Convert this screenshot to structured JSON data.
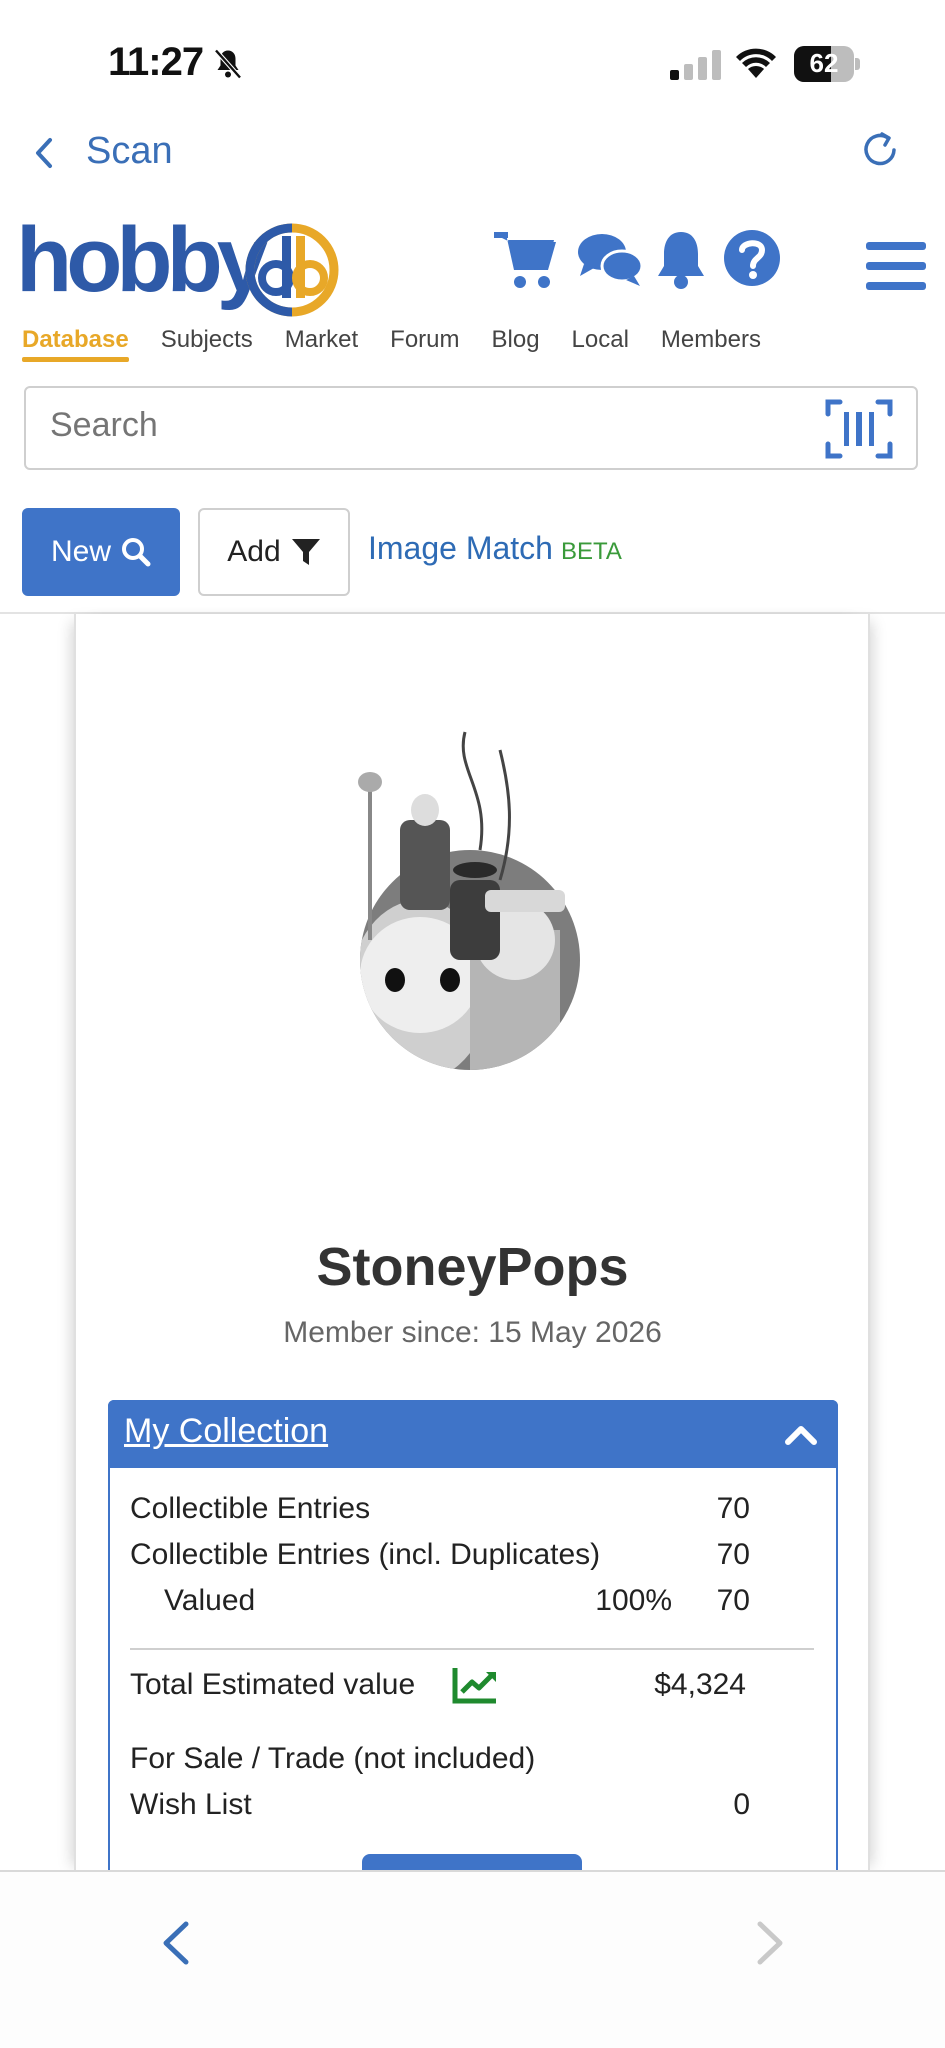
{
  "status_bar": {
    "time": "11:27",
    "battery": "62"
  },
  "nav": {
    "back_label": "Scan"
  },
  "header": {
    "logo_text": "hobby",
    "tabs": [
      {
        "label": "Database",
        "active": true
      },
      {
        "label": "Subjects",
        "active": false
      },
      {
        "label": "Market",
        "active": false
      },
      {
        "label": "Forum",
        "active": false
      },
      {
        "label": "Blog",
        "active": false
      },
      {
        "label": "Local",
        "active": false
      },
      {
        "label": "Members",
        "active": false
      }
    ]
  },
  "search": {
    "placeholder": "Search"
  },
  "actions": {
    "new_label": "New",
    "add_label": "Add",
    "image_match_label": "Image Match",
    "beta_label": "BETA"
  },
  "profile": {
    "username": "StoneyPops",
    "member_since": "Member since: 15 May 2026"
  },
  "collection": {
    "title": "My Collection",
    "rows": {
      "entries_label": "Collectible Entries",
      "entries_value": "70",
      "dups_label": "Collectible Entries (incl. Duplicates)",
      "dups_value": "70",
      "valued_label": "Valued",
      "valued_pct": "100%",
      "valued_value": "70",
      "total_label": "Total Estimated value",
      "total_value": "$4,324",
      "sale_label": "For Sale / Trade (not included)",
      "wish_label": "Wish List",
      "wish_value": "0"
    }
  },
  "colors": {
    "primary": "#3f74c8",
    "accent": "#e8a828",
    "trend": "#1f8a2e"
  }
}
